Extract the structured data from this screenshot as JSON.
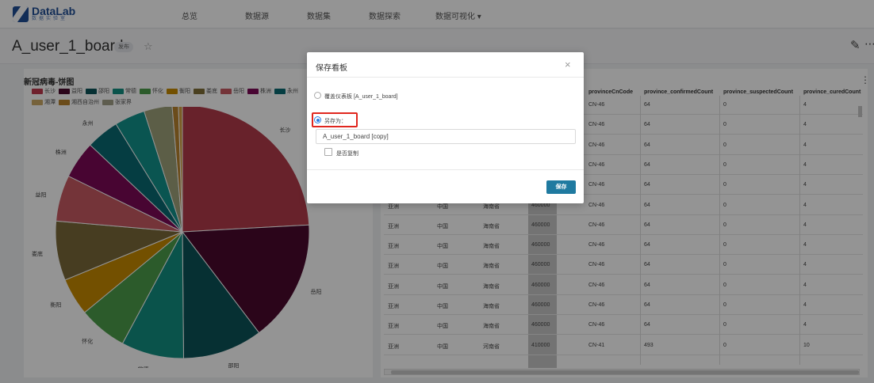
{
  "app": {
    "logo_name": "DataLab",
    "logo_sub": "数据实验室"
  },
  "nav": [
    {
      "label": "总览"
    },
    {
      "label": "数据源"
    },
    {
      "label": "数据集"
    },
    {
      "label": "数据探索"
    },
    {
      "label": "数据可视化 ▾"
    }
  ],
  "titlebar": {
    "title": "A_user_1_board",
    "badge": "发布"
  },
  "pie_panel": {
    "title": "新冠病毒-饼图",
    "legend_row1": [
      "长沙",
      "益阳",
      "邵阳",
      "常德",
      "怀化",
      "衡阳",
      "娄底",
      "岳阳",
      "株洲",
      "永州"
    ],
    "legend_row2": [
      "湘潭",
      "湘西自治州",
      "张家界"
    ],
    "legend_colors": [
      "#c0394f",
      "#4a0a2e",
      "#0c5358",
      "#128f82",
      "#4d9e4a",
      "#c78a00",
      "#806e38",
      "#c95a62",
      "#7c0a56",
      "#0a6a72",
      "#ccaa66",
      "#b9832d",
      "#a2a088"
    ]
  },
  "chart_data": {
    "type": "pie",
    "title": "新冠病毒-饼图",
    "categories": [
      "长沙",
      "岳阳",
      "邵阳",
      "常德",
      "怀化",
      "衡阳",
      "娄底",
      "益阳",
      "株洲",
      "永州",
      "郴州",
      "湘潭",
      "湘西自治州",
      "张家界"
    ],
    "values": [
      242,
      156,
      102,
      80,
      62,
      48,
      76,
      59,
      48,
      42,
      39,
      36,
      8,
      5
    ],
    "colors": [
      "#b33b4a",
      "#4a0a2e",
      "#0c5358",
      "#128f82",
      "#4d9e4a",
      "#c78a00",
      "#7a6a3a",
      "#c95a62",
      "#7c0a56",
      "#0a6a72",
      "#12938c",
      "#9fa37a",
      "#b9832d",
      "#d4a040"
    ]
  },
  "table": {
    "headers": [
      "provinceCnCode",
      "province_confirmedCount",
      "province_suspectedCount",
      "province_curedCount"
    ],
    "rows": [
      {
        "c1": "",
        "c2": "",
        "c3": "",
        "zip": "",
        "code": "CN-46",
        "confirmed": "64",
        "suspected": "0",
        "cured": "4"
      },
      {
        "c1": "",
        "c2": "",
        "c3": "",
        "zip": "",
        "code": "CN-46",
        "confirmed": "64",
        "suspected": "0",
        "cured": "4"
      },
      {
        "c1": "",
        "c2": "",
        "c3": "",
        "zip": "",
        "code": "CN-46",
        "confirmed": "64",
        "suspected": "0",
        "cured": "4"
      },
      {
        "c1": "",
        "c2": "",
        "c3": "",
        "zip": "",
        "code": "CN-46",
        "confirmed": "64",
        "suspected": "0",
        "cured": "4"
      },
      {
        "c1": "",
        "c2": "",
        "c3": "",
        "zip": "",
        "code": "CN-46",
        "confirmed": "64",
        "suspected": "0",
        "cured": "4"
      },
      {
        "c1": "亚洲",
        "c2": "中国",
        "c3": "海南省",
        "zip": "460000",
        "code": "CN-46",
        "confirmed": "64",
        "suspected": "0",
        "cured": "4"
      },
      {
        "c1": "亚洲",
        "c2": "中国",
        "c3": "海南省",
        "zip": "460000",
        "code": "CN-46",
        "confirmed": "64",
        "suspected": "0",
        "cured": "4"
      },
      {
        "c1": "亚洲",
        "c2": "中国",
        "c3": "海南省",
        "zip": "460000",
        "code": "CN-46",
        "confirmed": "64",
        "suspected": "0",
        "cured": "4"
      },
      {
        "c1": "亚洲",
        "c2": "中国",
        "c3": "海南省",
        "zip": "460000",
        "code": "CN-46",
        "confirmed": "64",
        "suspected": "0",
        "cured": "4"
      },
      {
        "c1": "亚洲",
        "c2": "中国",
        "c3": "海南省",
        "zip": "460000",
        "code": "CN-46",
        "confirmed": "64",
        "suspected": "0",
        "cured": "4"
      },
      {
        "c1": "亚洲",
        "c2": "中国",
        "c3": "海南省",
        "zip": "460000",
        "code": "CN-46",
        "confirmed": "64",
        "suspected": "0",
        "cured": "4"
      },
      {
        "c1": "亚洲",
        "c2": "中国",
        "c3": "海南省",
        "zip": "460000",
        "code": "CN-46",
        "confirmed": "64",
        "suspected": "0",
        "cured": "4"
      },
      {
        "c1": "亚洲",
        "c2": "中国",
        "c3": "河南省",
        "zip": "410000",
        "code": "CN-41",
        "confirmed": "493",
        "suspected": "0",
        "cured": "10"
      }
    ]
  },
  "modal": {
    "title": "保存看板",
    "close": "×",
    "option_overwrite": "覆盖仪表板 [A_user_1_board]",
    "option_save_as": "另存为：",
    "save_as_value": "A_user_1_board [copy]",
    "copy_checkbox_label": "是否复制",
    "save_button": "保存"
  }
}
